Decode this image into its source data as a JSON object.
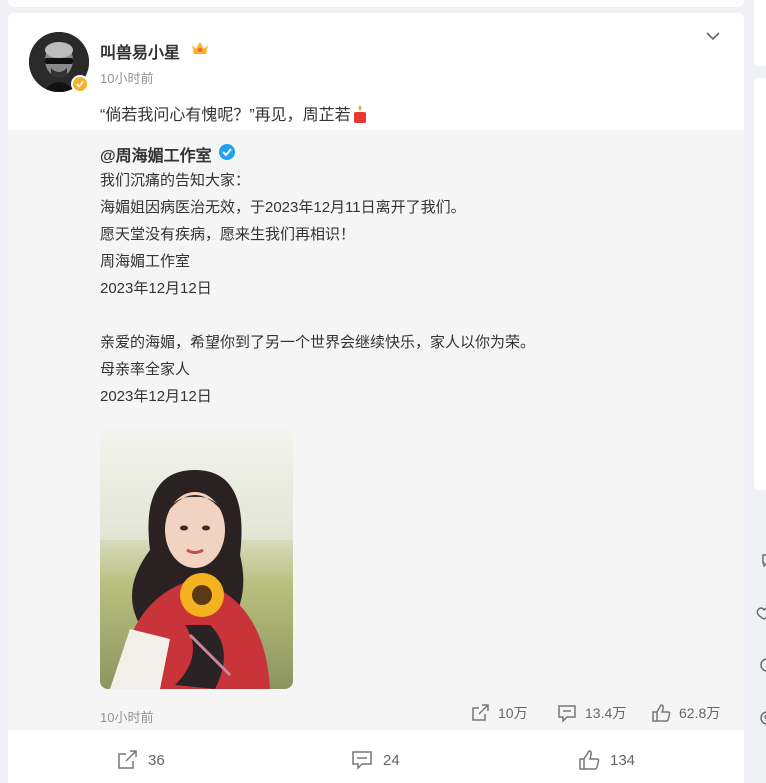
{
  "post": {
    "author": "叫兽易小星",
    "time": "10小时前",
    "text": "“倘若我问心有愧呢？”再见，周芷若"
  },
  "repost": {
    "author": "@周海媚工作室",
    "lines": [
      "我们沉痛的告知大家：",
      "海媚姐因病医治无效，于2023年12月11日离开了我们。",
      "愿天堂没有疾病，愿来生我们再相识！",
      "周海媚工作室",
      "2023年12月12日",
      "亲爱的海媚，希望你到了另一个世界会继续快乐，家人以你为荣。",
      "母亲率全家人",
      "2023年12月12日"
    ],
    "time": "10小时前",
    "stats": {
      "reposts": "10万",
      "comments": "13.4万",
      "likes": "62.8万"
    }
  },
  "actions": {
    "reposts": "36",
    "comments": "24",
    "likes": "134"
  },
  "colors": {
    "accent": "#ff8200",
    "verified_blue": "#1da1f2",
    "verified_gold": "#f7b22c"
  }
}
